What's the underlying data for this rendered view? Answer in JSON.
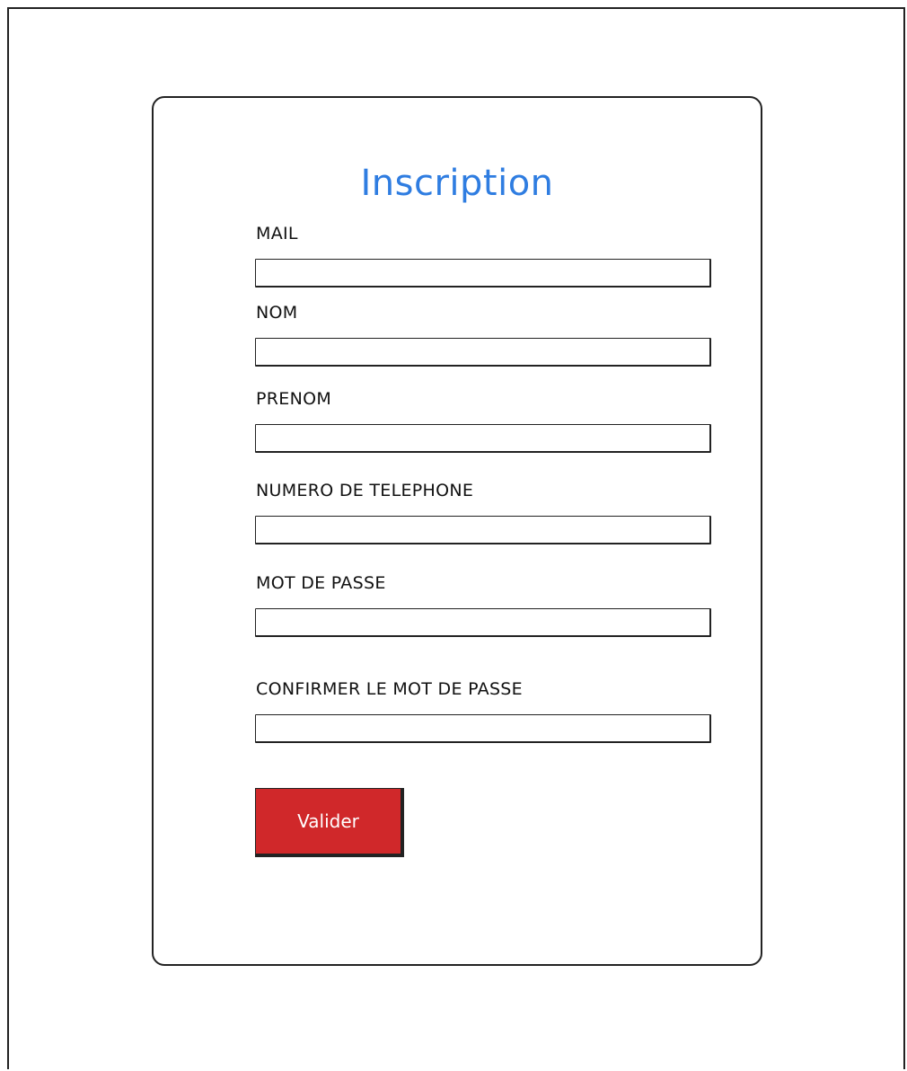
{
  "form": {
    "title": "Inscription",
    "fields": [
      {
        "label": "MAIL",
        "value": "",
        "placeholder": ""
      },
      {
        "label": "NOM",
        "value": "",
        "placeholder": ""
      },
      {
        "label": "PRENOM",
        "value": "",
        "placeholder": ""
      },
      {
        "label": "NUMERO DE TELEPHONE",
        "value": "",
        "placeholder": ""
      },
      {
        "label": "MOT DE PASSE",
        "value": "",
        "placeholder": ""
      },
      {
        "label": "CONFIRMER LE MOT DE PASSE",
        "value": "",
        "placeholder": ""
      }
    ],
    "submit_label": "Valider"
  },
  "colors": {
    "title": "#2f7de1",
    "button_background": "#d0282a",
    "button_text": "#ffffff",
    "border": "#222222"
  }
}
